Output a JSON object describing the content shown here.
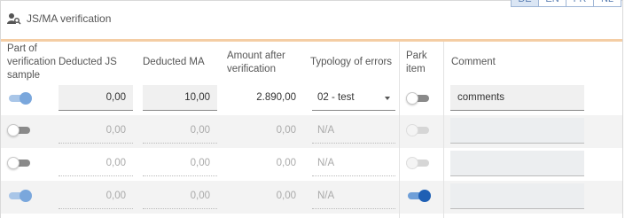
{
  "section": {
    "title": "JS/MA verification",
    "icon": "user-search-icon"
  },
  "languages": [
    "DE",
    "EN",
    "FR",
    "NL"
  ],
  "columns": {
    "part_of_sample": "Part of verification sample",
    "deducted_js": "Deducted JS",
    "deducted_ma": "Deducted MA",
    "amount_after": "Amount after verification",
    "typology": "Typology of errors",
    "park_item": "Park item",
    "comment": "Comment"
  },
  "rows": [
    {
      "sample_on": true,
      "deducted_js": "0,00",
      "deducted_ma": "10,00",
      "amount": "2.890,00",
      "typology": "02 - test",
      "park_on": false,
      "park_disabled": false,
      "comment": "comments",
      "editable": true
    },
    {
      "sample_on": false,
      "deducted_js": "0,00",
      "deducted_ma": "0,00",
      "amount": "0,00",
      "typology": "N/A",
      "park_on": false,
      "park_disabled": true,
      "comment": "",
      "editable": false
    },
    {
      "sample_on": false,
      "deducted_js": "0,00",
      "deducted_ma": "0,00",
      "amount": "0,00",
      "typology": "N/A",
      "park_on": false,
      "park_disabled": true,
      "comment": "",
      "editable": false
    },
    {
      "sample_on": true,
      "deducted_js": "0,00",
      "deducted_ma": "0,00",
      "amount": "0,00",
      "typology": "N/A",
      "park_on": true,
      "park_disabled": false,
      "comment": "",
      "editable": false
    }
  ]
}
